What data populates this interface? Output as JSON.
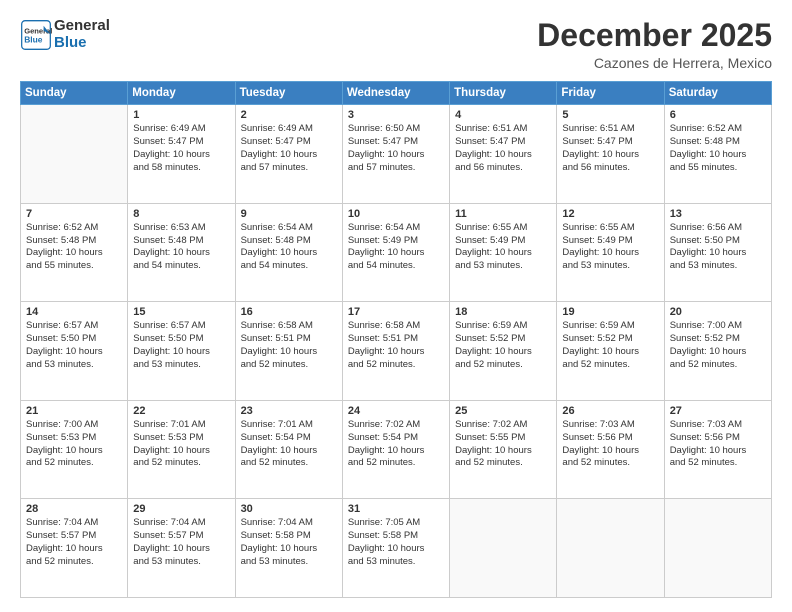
{
  "logo": {
    "text_general": "General",
    "text_blue": "Blue"
  },
  "header": {
    "month": "December 2025",
    "location": "Cazones de Herrera, Mexico"
  },
  "days_of_week": [
    "Sunday",
    "Monday",
    "Tuesday",
    "Wednesday",
    "Thursday",
    "Friday",
    "Saturday"
  ],
  "weeks": [
    [
      {
        "day": "",
        "empty": true
      },
      {
        "day": "1",
        "line1": "Sunrise: 6:49 AM",
        "line2": "Sunset: 5:47 PM",
        "line3": "Daylight: 10 hours",
        "line4": "and 58 minutes."
      },
      {
        "day": "2",
        "line1": "Sunrise: 6:49 AM",
        "line2": "Sunset: 5:47 PM",
        "line3": "Daylight: 10 hours",
        "line4": "and 57 minutes."
      },
      {
        "day": "3",
        "line1": "Sunrise: 6:50 AM",
        "line2": "Sunset: 5:47 PM",
        "line3": "Daylight: 10 hours",
        "line4": "and 57 minutes."
      },
      {
        "day": "4",
        "line1": "Sunrise: 6:51 AM",
        "line2": "Sunset: 5:47 PM",
        "line3": "Daylight: 10 hours",
        "line4": "and 56 minutes."
      },
      {
        "day": "5",
        "line1": "Sunrise: 6:51 AM",
        "line2": "Sunset: 5:47 PM",
        "line3": "Daylight: 10 hours",
        "line4": "and 56 minutes."
      },
      {
        "day": "6",
        "line1": "Sunrise: 6:52 AM",
        "line2": "Sunset: 5:48 PM",
        "line3": "Daylight: 10 hours",
        "line4": "and 55 minutes."
      }
    ],
    [
      {
        "day": "7",
        "line1": "Sunrise: 6:52 AM",
        "line2": "Sunset: 5:48 PM",
        "line3": "Daylight: 10 hours",
        "line4": "and 55 minutes."
      },
      {
        "day": "8",
        "line1": "Sunrise: 6:53 AM",
        "line2": "Sunset: 5:48 PM",
        "line3": "Daylight: 10 hours",
        "line4": "and 54 minutes."
      },
      {
        "day": "9",
        "line1": "Sunrise: 6:54 AM",
        "line2": "Sunset: 5:48 PM",
        "line3": "Daylight: 10 hours",
        "line4": "and 54 minutes."
      },
      {
        "day": "10",
        "line1": "Sunrise: 6:54 AM",
        "line2": "Sunset: 5:49 PM",
        "line3": "Daylight: 10 hours",
        "line4": "and 54 minutes."
      },
      {
        "day": "11",
        "line1": "Sunrise: 6:55 AM",
        "line2": "Sunset: 5:49 PM",
        "line3": "Daylight: 10 hours",
        "line4": "and 53 minutes."
      },
      {
        "day": "12",
        "line1": "Sunrise: 6:55 AM",
        "line2": "Sunset: 5:49 PM",
        "line3": "Daylight: 10 hours",
        "line4": "and 53 minutes."
      },
      {
        "day": "13",
        "line1": "Sunrise: 6:56 AM",
        "line2": "Sunset: 5:50 PM",
        "line3": "Daylight: 10 hours",
        "line4": "and 53 minutes."
      }
    ],
    [
      {
        "day": "14",
        "line1": "Sunrise: 6:57 AM",
        "line2": "Sunset: 5:50 PM",
        "line3": "Daylight: 10 hours",
        "line4": "and 53 minutes."
      },
      {
        "day": "15",
        "line1": "Sunrise: 6:57 AM",
        "line2": "Sunset: 5:50 PM",
        "line3": "Daylight: 10 hours",
        "line4": "and 53 minutes."
      },
      {
        "day": "16",
        "line1": "Sunrise: 6:58 AM",
        "line2": "Sunset: 5:51 PM",
        "line3": "Daylight: 10 hours",
        "line4": "and 52 minutes."
      },
      {
        "day": "17",
        "line1": "Sunrise: 6:58 AM",
        "line2": "Sunset: 5:51 PM",
        "line3": "Daylight: 10 hours",
        "line4": "and 52 minutes."
      },
      {
        "day": "18",
        "line1": "Sunrise: 6:59 AM",
        "line2": "Sunset: 5:52 PM",
        "line3": "Daylight: 10 hours",
        "line4": "and 52 minutes."
      },
      {
        "day": "19",
        "line1": "Sunrise: 6:59 AM",
        "line2": "Sunset: 5:52 PM",
        "line3": "Daylight: 10 hours",
        "line4": "and 52 minutes."
      },
      {
        "day": "20",
        "line1": "Sunrise: 7:00 AM",
        "line2": "Sunset: 5:52 PM",
        "line3": "Daylight: 10 hours",
        "line4": "and 52 minutes."
      }
    ],
    [
      {
        "day": "21",
        "line1": "Sunrise: 7:00 AM",
        "line2": "Sunset: 5:53 PM",
        "line3": "Daylight: 10 hours",
        "line4": "and 52 minutes."
      },
      {
        "day": "22",
        "line1": "Sunrise: 7:01 AM",
        "line2": "Sunset: 5:53 PM",
        "line3": "Daylight: 10 hours",
        "line4": "and 52 minutes."
      },
      {
        "day": "23",
        "line1": "Sunrise: 7:01 AM",
        "line2": "Sunset: 5:54 PM",
        "line3": "Daylight: 10 hours",
        "line4": "and 52 minutes."
      },
      {
        "day": "24",
        "line1": "Sunrise: 7:02 AM",
        "line2": "Sunset: 5:54 PM",
        "line3": "Daylight: 10 hours",
        "line4": "and 52 minutes."
      },
      {
        "day": "25",
        "line1": "Sunrise: 7:02 AM",
        "line2": "Sunset: 5:55 PM",
        "line3": "Daylight: 10 hours",
        "line4": "and 52 minutes."
      },
      {
        "day": "26",
        "line1": "Sunrise: 7:03 AM",
        "line2": "Sunset: 5:56 PM",
        "line3": "Daylight: 10 hours",
        "line4": "and 52 minutes."
      },
      {
        "day": "27",
        "line1": "Sunrise: 7:03 AM",
        "line2": "Sunset: 5:56 PM",
        "line3": "Daylight: 10 hours",
        "line4": "and 52 minutes."
      }
    ],
    [
      {
        "day": "28",
        "line1": "Sunrise: 7:04 AM",
        "line2": "Sunset: 5:57 PM",
        "line3": "Daylight: 10 hours",
        "line4": "and 52 minutes."
      },
      {
        "day": "29",
        "line1": "Sunrise: 7:04 AM",
        "line2": "Sunset: 5:57 PM",
        "line3": "Daylight: 10 hours",
        "line4": "and 53 minutes."
      },
      {
        "day": "30",
        "line1": "Sunrise: 7:04 AM",
        "line2": "Sunset: 5:58 PM",
        "line3": "Daylight: 10 hours",
        "line4": "and 53 minutes."
      },
      {
        "day": "31",
        "line1": "Sunrise: 7:05 AM",
        "line2": "Sunset: 5:58 PM",
        "line3": "Daylight: 10 hours",
        "line4": "and 53 minutes."
      },
      {
        "day": "",
        "empty": true
      },
      {
        "day": "",
        "empty": true
      },
      {
        "day": "",
        "empty": true
      }
    ]
  ]
}
